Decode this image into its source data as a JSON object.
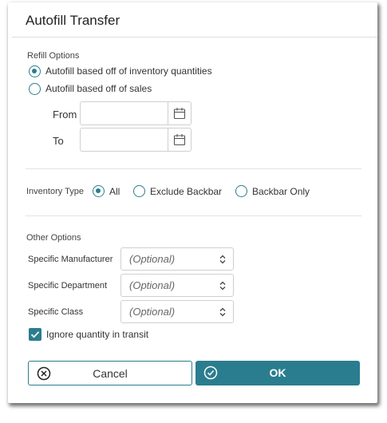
{
  "dialog": {
    "title": "Autofill Transfer",
    "refill_options": {
      "label": "Refill Options",
      "options": [
        {
          "label": "Autofill based off of inventory quantities",
          "selected": true
        },
        {
          "label": "Autofill based off of sales",
          "selected": false
        }
      ],
      "from_label": "From",
      "to_label": "To"
    },
    "inventory_type": {
      "label": "Inventory Type",
      "options": [
        {
          "label": "All",
          "selected": true
        },
        {
          "label": "Exclude Backbar",
          "selected": false
        },
        {
          "label": "Backbar Only",
          "selected": false
        }
      ]
    },
    "other_options": {
      "label": "Other Options",
      "fields": [
        {
          "label": "Specific Manufacturer",
          "placeholder": "(Optional)"
        },
        {
          "label": "Specific Department",
          "placeholder": "(Optional)"
        },
        {
          "label": "Specific Class",
          "placeholder": "(Optional)"
        }
      ],
      "ignore_transit": {
        "label": "Ignore quantity in transit",
        "checked": true
      }
    },
    "buttons": {
      "cancel": "Cancel",
      "ok": "OK"
    },
    "accent_color": "#2a7d8e"
  }
}
